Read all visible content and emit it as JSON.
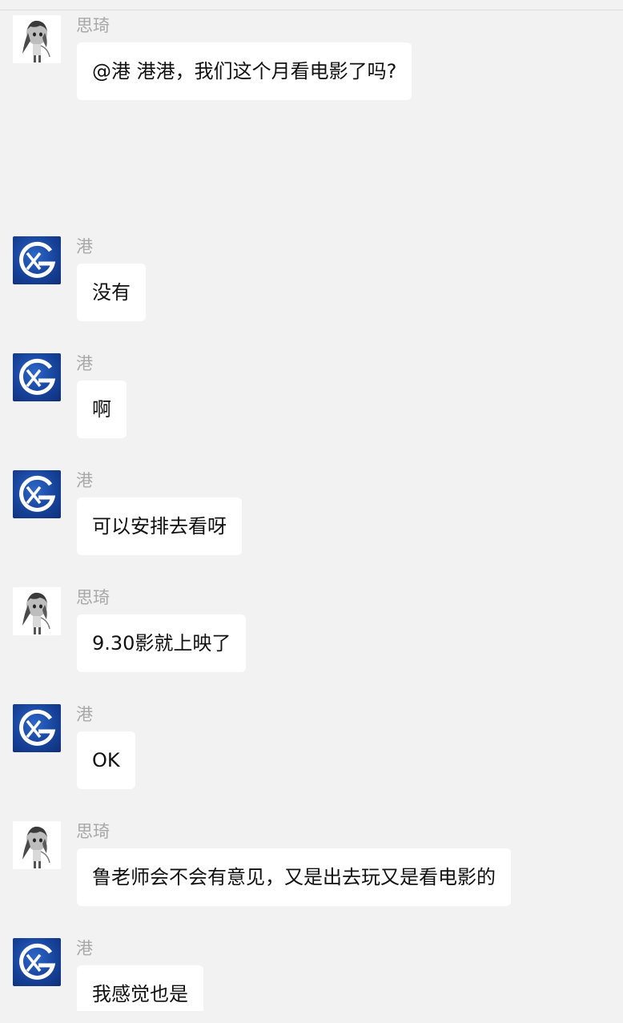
{
  "messages": [
    {
      "sender": "思琦",
      "avatar": "sketch-girl-avatar",
      "text": "@港 港港，我们这个月看电影了吗?"
    },
    {
      "sender": "港",
      "avatar": "xg-logo-avatar",
      "text": "没有"
    },
    {
      "sender": "港",
      "avatar": "xg-logo-avatar",
      "text": "啊"
    },
    {
      "sender": "港",
      "avatar": "xg-logo-avatar",
      "text": "可以安排去看呀"
    },
    {
      "sender": "思琦",
      "avatar": "sketch-girl-avatar",
      "text": "9.30影就上映了"
    },
    {
      "sender": "港",
      "avatar": "xg-logo-avatar",
      "text": "OK"
    },
    {
      "sender": "思琦",
      "avatar": "sketch-girl-avatar",
      "text": "鲁老师会不会有意见，又是出去玩又是看电影的"
    },
    {
      "sender": "港",
      "avatar": "xg-logo-avatar",
      "text": "我感觉也是"
    }
  ],
  "colors": {
    "background": "#f2f2f2",
    "bubble": "#ffffff",
    "sender_name": "#a8a8a8",
    "logo_blue": "#17439b"
  }
}
